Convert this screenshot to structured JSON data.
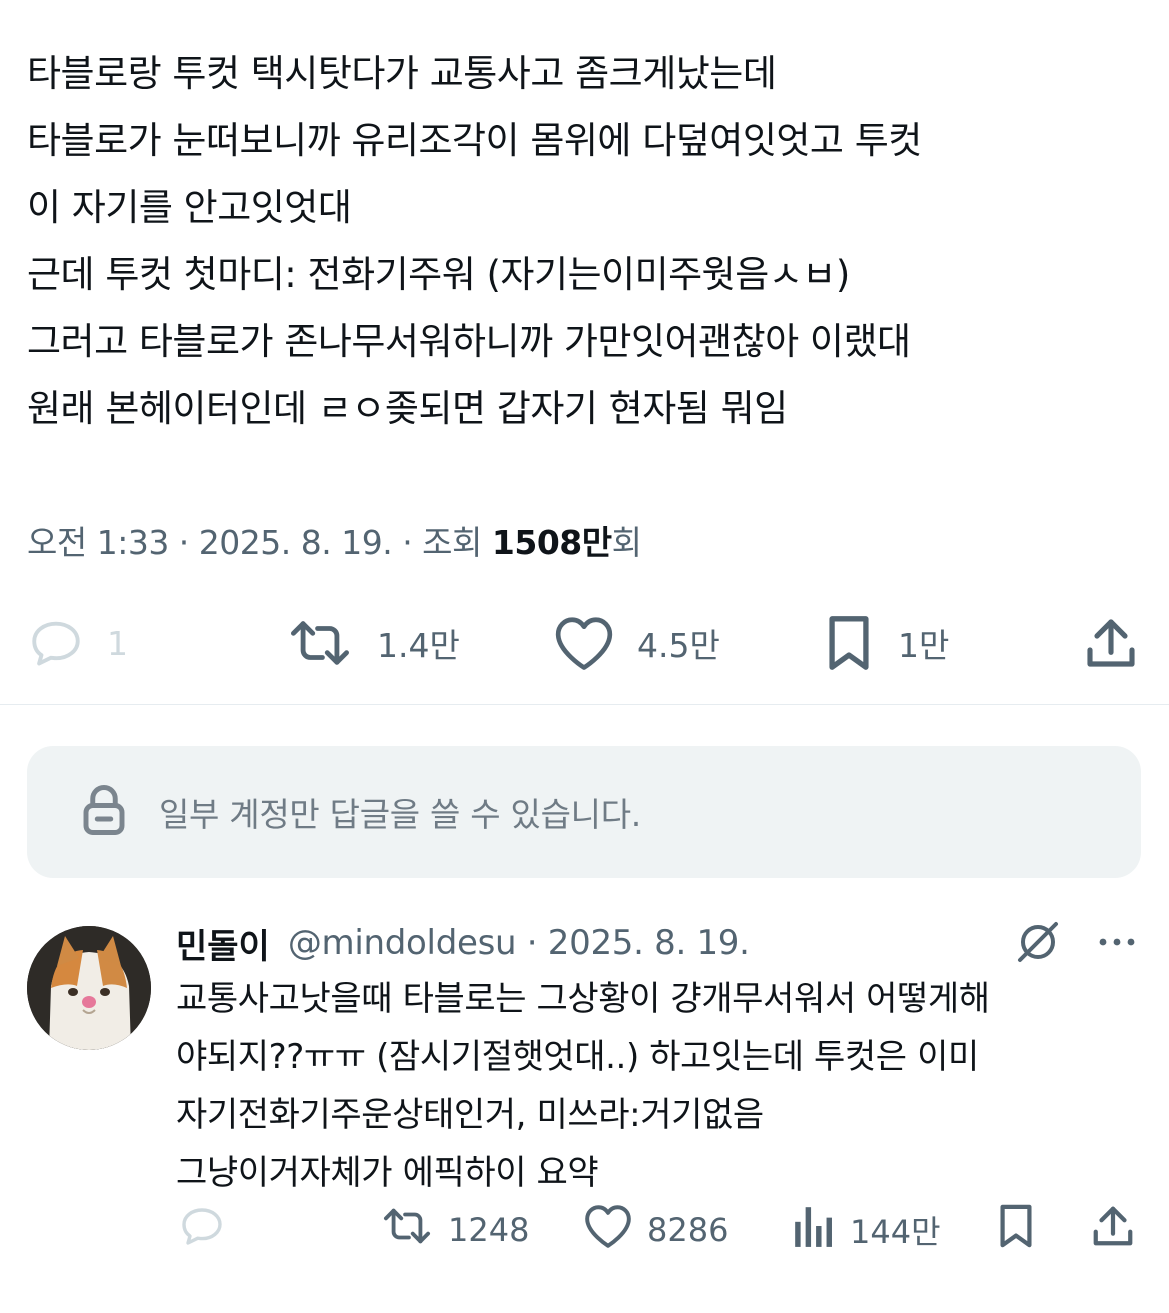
{
  "tweet": {
    "lines": [
      "타블로랑 투컷 택시탓다가 교통사고 좀크게났는데",
      "타블로가 눈떠보니까 유리조각이 몸위에 다덮여잇엇고 투컷",
      "이 자기를 안고잇엇대",
      "근데 투컷 첫마디: 전화기주워 (자기는이미주웟음ㅅㅂ)",
      "그러고 타블로가 존나무서워하니까 가만잇어괜찮아 이랬대",
      "원래 본헤이터인데 ㄹㅇ좆되면 갑자기 현자됨 뭐임"
    ],
    "meta": {
      "time_date": "오전 1:33 · 2025. 8. 19. · 조회 ",
      "views": "1508만",
      "views_suffix": "회"
    },
    "actions": {
      "reply_icon": "reply-icon",
      "reply_count": "1",
      "retweet_icon": "retweet-icon",
      "retweet_count": "1.4만",
      "like_icon": "heart-icon",
      "like_count": "4.5만",
      "bookmark_icon": "bookmark-icon",
      "bookmark_count": "1만",
      "share_icon": "share-icon"
    }
  },
  "reply_restriction": {
    "icon": "lock-icon",
    "text": "일부 계정만 답글을 쓸 수 있습니다."
  },
  "reply": {
    "avatar_icon": "cat-avatar",
    "name": "민돌이",
    "handle_date": "@mindoldesu · 2025. 8. 19.",
    "grok_icon": "grok-icon",
    "more_icon": "more-icon",
    "lines": [
      "교통사고낫을때 타블로는 그상황이 걍개무서워서 어떻게해",
      "야되지??ㅠㅠ (잠시기절햇엇대..)  하고잇는데 투컷은 이미",
      "자기전화기주운상태인거, 미쓰라:거기없음",
      "그냥이거자체가 에픽하이 요약"
    ],
    "actions": {
      "reply_icon": "reply-icon",
      "retweet_icon": "retweet-icon",
      "retweet_count": "1248",
      "like_icon": "heart-icon",
      "like_count": "8286",
      "views_icon": "views-icon",
      "views_count": "144만",
      "bookmark_icon": "bookmark-icon",
      "share_icon": "share-icon"
    }
  },
  "colors": {
    "text": "#0f1419",
    "secondary": "#536471",
    "disabled": "#cfd9de",
    "restricted_bg": "#eff3f4",
    "divider": "#e6ecf0"
  }
}
